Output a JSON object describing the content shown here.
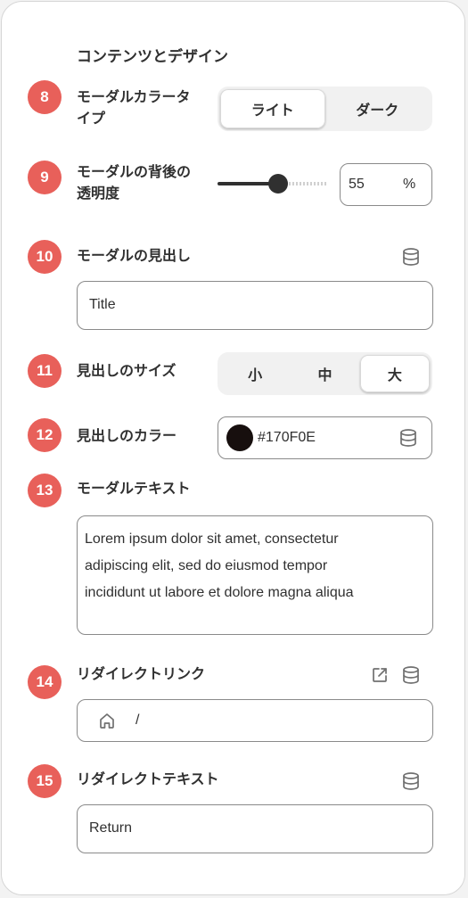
{
  "section": {
    "title": "コンテンツとデザイン"
  },
  "rows": {
    "modal_color_type": {
      "badge": "8",
      "label_line1": "モーダルカラータ",
      "label_line2": "イプ",
      "options": [
        "ライト",
        "ダーク"
      ],
      "selected": "ライト"
    },
    "backdrop_opacity": {
      "badge": "9",
      "label_line1": "モーダルの背後の",
      "label_line2": "透明度",
      "value": "55",
      "unit": "%",
      "slider_fraction": 0.55
    },
    "modal_heading": {
      "badge": "10",
      "label": "モーダルの見出し",
      "value": "Title"
    },
    "heading_size": {
      "badge": "11",
      "label": "見出しのサイズ",
      "options": [
        "小",
        "中",
        "大"
      ],
      "selected": "大"
    },
    "heading_color": {
      "badge": "12",
      "label": "見出しのカラー",
      "value": "#170F0E",
      "swatch": "#170F0E"
    },
    "modal_text": {
      "badge": "13",
      "label": "モーダルテキスト",
      "line1": "Lorem ipsum dolor sit amet, consectetur",
      "line2": "adipiscing elit, sed do eiusmod tempor",
      "line3": "incididunt ut labore et dolore magna aliqua"
    },
    "redirect_link": {
      "badge": "14",
      "label": "リダイレクトリンク",
      "value": "/"
    },
    "redirect_text": {
      "badge": "15",
      "label": "リダイレクトテキスト",
      "value": "Return"
    }
  },
  "colors": {
    "badge": "#E8605A",
    "border": "#8A8A8A",
    "text": "#303030"
  },
  "icons": {
    "dynamic_source": "database-icon",
    "external": "external-link-icon",
    "home": "home-icon"
  }
}
